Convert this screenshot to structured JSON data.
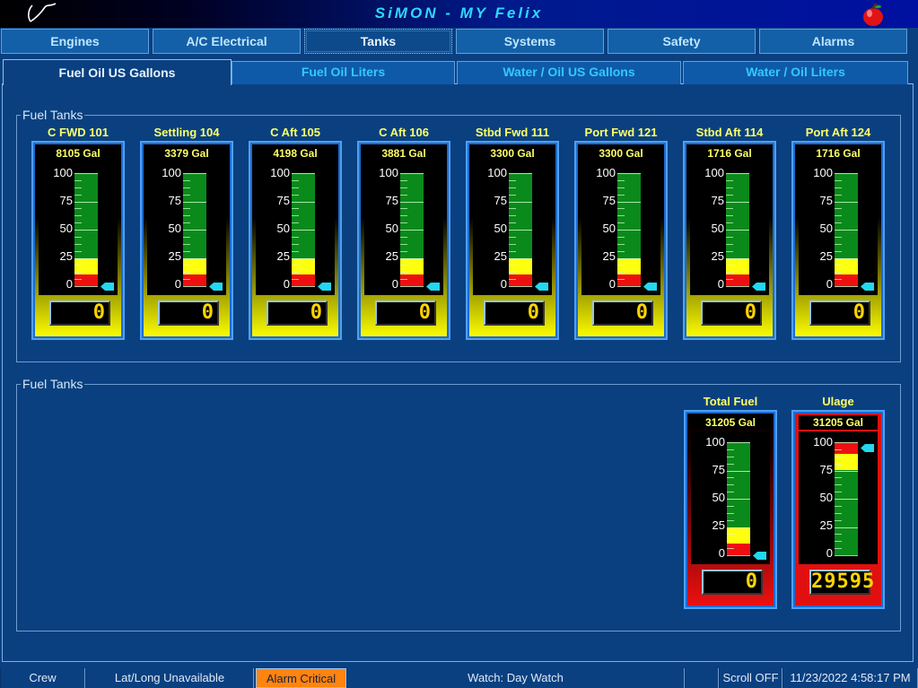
{
  "window": {
    "title": "SiMON  -  MY  Felix",
    "logo_icon": "signature-logo-icon",
    "apple_icon": "apple-icon"
  },
  "main_tabs": [
    {
      "label": "Engines"
    },
    {
      "label": "A/C Electrical"
    },
    {
      "label": "Tanks",
      "active": true
    },
    {
      "label": "Systems"
    },
    {
      "label": "Safety"
    },
    {
      "label": "Alarms"
    }
  ],
  "sub_tabs": [
    {
      "label": "Fuel Oil US Gallons",
      "active": true
    },
    {
      "label": "Fuel Oil Liters"
    },
    {
      "label": "Water / Oil US Gallons"
    },
    {
      "label": "Water / Oil Liters"
    }
  ],
  "groups": {
    "top_title": "Fuel Tanks",
    "bottom_title": "Fuel Tanks"
  },
  "scale_labels": [
    "100",
    "75",
    "50",
    "25",
    "0"
  ],
  "tanks": [
    {
      "name": "C FWD 101",
      "capacity": "8105 Gal",
      "reading": "0",
      "level_percent": 0
    },
    {
      "name": "Settling 104",
      "capacity": "3379 Gal",
      "reading": "0",
      "level_percent": 0
    },
    {
      "name": "C Aft 105",
      "capacity": "4198 Gal",
      "reading": "0",
      "level_percent": 0
    },
    {
      "name": "C Aft 106",
      "capacity": "3881 Gal",
      "reading": "0",
      "level_percent": 0
    },
    {
      "name": "Stbd Fwd 111",
      "capacity": "3300 Gal",
      "reading": "0",
      "level_percent": 0
    },
    {
      "name": "Port Fwd 121",
      "capacity": "3300 Gal",
      "reading": "0",
      "level_percent": 0
    },
    {
      "name": "Stbd Aft 114",
      "capacity": "1716 Gal",
      "reading": "0",
      "level_percent": 0
    },
    {
      "name": "Port Aft 124",
      "capacity": "1716 Gal",
      "reading": "0",
      "level_percent": 0
    }
  ],
  "totals": [
    {
      "name": "Total Fuel",
      "capacity": "31205 Gal",
      "reading": "0",
      "level_percent": 0
    },
    {
      "name": "Ulage",
      "capacity": "31205 Gal",
      "reading": "29595",
      "level_percent": 95
    }
  ],
  "status_bar": {
    "crew": "Crew",
    "position": "Lat/Long Unavailable",
    "alarm": "Alarm Critical",
    "watch": "Watch: Day Watch",
    "blank": "",
    "scroll": "Scroll OFF",
    "datetime": "11/23/2022 4:58:17 PM"
  },
  "colors": {
    "accent": "#2ed8ff",
    "panel": "#0a4080",
    "gauge_label": "#ffff66",
    "alarm": "#ff8410"
  }
}
